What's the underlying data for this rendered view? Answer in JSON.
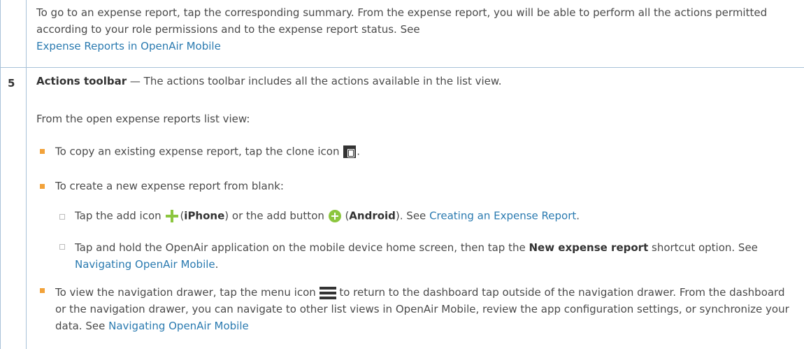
{
  "intro": {
    "text": "To go to an expense report, tap the corresponding summary. From the expense report, you will be able to perform all the actions permitted according to your role permissions and to the expense report status. See",
    "link": "Expense Reports in OpenAir Mobile"
  },
  "row": {
    "number": "5",
    "title": "Actions toolbar",
    "title_rest": " — The actions toolbar includes all the actions available in the list view.",
    "from_list": "From the open expense reports list view:",
    "bullet1": "To copy an existing expense report, tap the clone icon",
    "bullet1_end": ".",
    "bullet2": "To create a new expense report from blank:",
    "sub1": {
      "a": "Tap the add icon",
      "iphone": "iPhone",
      "b": ") or the add button",
      "android": "Android",
      "c": "). See",
      "link": "Creating an Expense Report",
      "d": "."
    },
    "sub2": {
      "a": "Tap and hold the OpenAir application on the mobile device home screen, then tap the",
      "bold": "New expense report",
      "b": "shortcut option. See",
      "link": "Navigating OpenAir Mobile",
      "c": "."
    },
    "bullet3": {
      "a": "To view the navigation drawer, tap the menu icon",
      "b": "to return to the dashboard tap outside of the navigation drawer. From the dashboard or the navigation drawer, you can navigate to other list views in OpenAir Mobile, review the app configuration settings, or synchronize your data. See",
      "link": "Navigating OpenAir Mobile"
    }
  },
  "colors": {
    "border": "#a9c2d8",
    "link": "#2a7ab0",
    "bullet": "#f2a23a",
    "add_icon": "#8cc63f"
  }
}
